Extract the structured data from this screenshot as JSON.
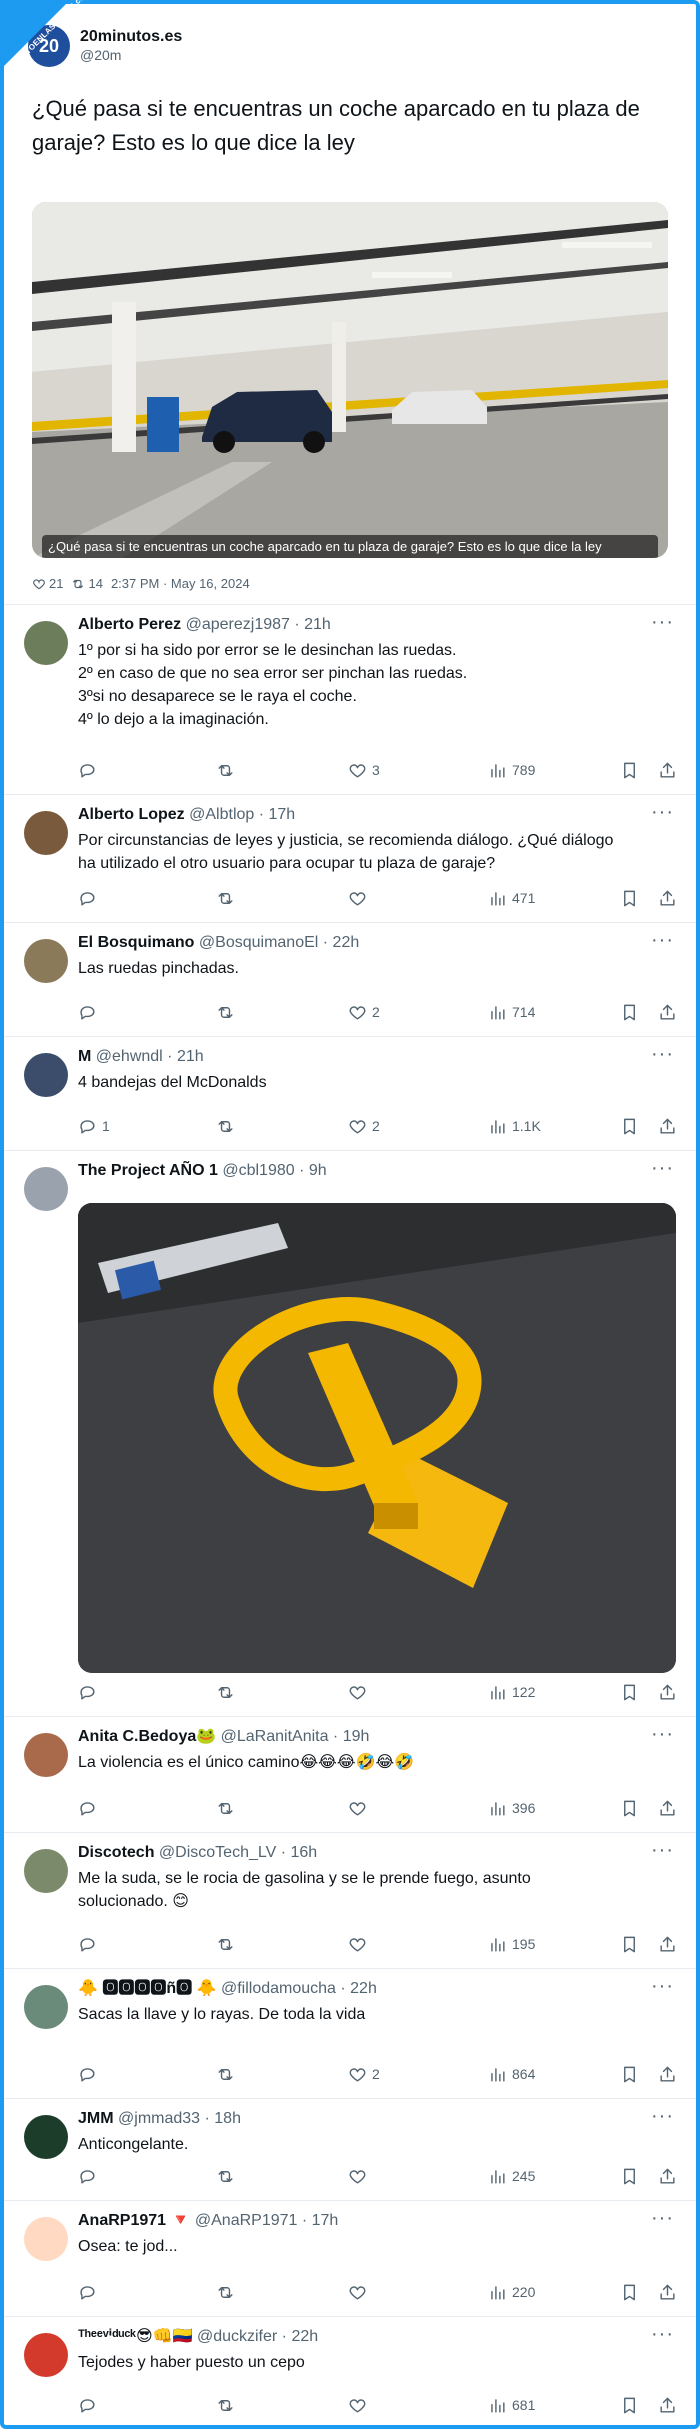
{
  "watermark": "VISTOENLASREDES.com",
  "main": {
    "avatar_text": "20",
    "name": "20minutos.es",
    "handle": "@20m",
    "text": "¿Qué pasa si te encuentras un coche aparcado en tu plaza de garaje? Esto es lo que dice la ley",
    "caption": "¿Qué pasa si te encuentras un coche aparcado en tu plaza de garaje? Esto es lo que dice la ley",
    "likes": "21",
    "retweets": "14",
    "timestamp": "2:37 PM · May 16, 2024"
  },
  "colors": {
    "accent": "#1d9bf0",
    "text": "#0f1419",
    "muted": "#536471",
    "pin_yellow": "#f5b800"
  },
  "icons": [
    "reply-icon",
    "retweet-icon",
    "heart-icon",
    "views-icon",
    "bookmark-icon",
    "share-icon",
    "more-icon"
  ],
  "replies": [
    {
      "name": "Alberto Perez",
      "handle": "@aperezj1987 · 21h",
      "lines": [
        "1º por si ha sido por error se le desinchan las ruedas.",
        "2º en caso de que no sea error ser pinchan las ruedas.",
        "3ºsi no desaparece se le raya el coche.",
        "4º lo dejo a la imaginación."
      ],
      "replies": "",
      "likes": "3",
      "views": "789"
    },
    {
      "name": "Alberto Lopez",
      "handle": "@Albtlop · 17h",
      "lines": [
        "Por circunstancias de leyes y justicia, se recomienda diálogo. ¿Qué diálogo",
        "ha utilizado el otro usuario para ocupar tu plaza de garaje?"
      ],
      "replies": "",
      "likes": "",
      "views": "471"
    },
    {
      "name": "El Bosquimano",
      "handle": "@BosquimanoEl · 22h",
      "lines": [
        "Las ruedas pinchadas."
      ],
      "replies": "",
      "likes": "2",
      "views": "714"
    },
    {
      "name": "M",
      "handle": "@ehwndl · 21h",
      "lines": [
        "4 bandejas del McDonalds"
      ],
      "replies": "1",
      "likes": "2",
      "views": "1.1K"
    },
    {
      "name": "The Project AÑO 1",
      "handle": "@cbl1980 · 9h",
      "lines": [],
      "replies": "",
      "likes": "",
      "views": "122"
    },
    {
      "name": "Anita C.Bedoya🐸",
      "handle": "@LaRanitAnita · 19h",
      "lines": [
        "La violencia es el único camino😂😂😂🤣😂🤣"
      ],
      "replies": "",
      "likes": "",
      "views": "396"
    },
    {
      "name": "Discotech",
      "handle": "@DiscoTech_LV · 16h",
      "lines": [
        "Me la suda, se le rocia de gasolina y se le prende fuego, asunto",
        "solucionado. 😊"
      ],
      "replies": "",
      "likes": "",
      "views": "195"
    },
    {
      "name": "🐥 🅾🅾🅾🅾ñ🅾 🐥",
      "handle": "@fillodamoucha · 22h",
      "lines": [
        "Sacas la llave y lo rayas. De toda la vida"
      ],
      "replies": "",
      "likes": "2",
      "views": "864"
    },
    {
      "name": "JMM",
      "handle": "@jmmad33 · 18h",
      "lines": [
        "Anticongelante."
      ],
      "replies": "",
      "likes": "",
      "views": "245"
    },
    {
      "name": "AnaRP1971 🔻",
      "handle": "@AnaRP1971 · 17h",
      "lines": [
        "Osea: te jod..."
      ],
      "replies": "",
      "likes": "",
      "views": "220"
    },
    {
      "name": "ᵀʰᵉᵉᵛⁱᵈᵘᶜᵏ😎👊🇨🇴",
      "handle": "@duckzifer · 22h",
      "lines": [
        "Tejodes y haber puesto un cepo"
      ],
      "replies": "",
      "likes": "",
      "views": "681"
    }
  ]
}
